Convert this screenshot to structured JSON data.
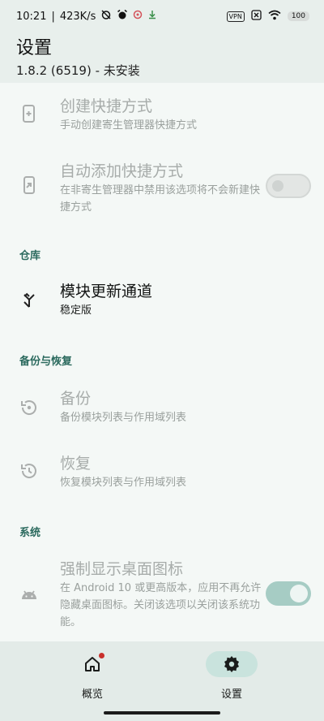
{
  "status_bar": {
    "time": "10:21",
    "network_speed": "423K/s",
    "vpn": "VPN",
    "battery": "100"
  },
  "app_bar": {
    "title": "设置",
    "subtitle": "1.8.2 (6519) - 未安装"
  },
  "items": {
    "create_shortcut": {
      "title": "创建快捷方式",
      "summary": "手动创建寄生管理器快捷方式"
    },
    "auto_shortcut": {
      "title": "自动添加快捷方式",
      "summary": "在非寄生管理器中禁用该选项将不会新建快捷方式",
      "switch_on": false
    },
    "update_channel": {
      "title": "模块更新通道",
      "summary": "稳定版"
    },
    "backup": {
      "title": "备份",
      "summary": "备份模块列表与作用域列表"
    },
    "restore": {
      "title": "恢复",
      "summary": "恢复模块列表与作用域列表"
    },
    "force_icon": {
      "title": "强制显示桌面图标",
      "summary": "在 Android 10 或更高版本，应用不再允许隐藏桌面图标。关闭该选项以关闭该系统功能。",
      "switch_on": true
    }
  },
  "sections": {
    "repo": "仓库",
    "backup_restore": "备份与恢复",
    "system": "系统"
  },
  "bottom_nav": {
    "overview": "概览",
    "settings": "设置"
  },
  "colors": {
    "accent": "#2b6a5e",
    "switch_on_track": "#a6ccc4",
    "nav_active_pill": "#c9e3dd",
    "badge": "#c9302c"
  },
  "icons": {
    "create_shortcut": "phone-add-icon",
    "auto_shortcut": "shortcut-icon",
    "update_channel": "merge-arrow-icon",
    "backup": "backup-restore-icon",
    "restore": "history-icon",
    "force_icon": "android-icon",
    "overview": "home-icon",
    "settings": "gear-icon"
  }
}
